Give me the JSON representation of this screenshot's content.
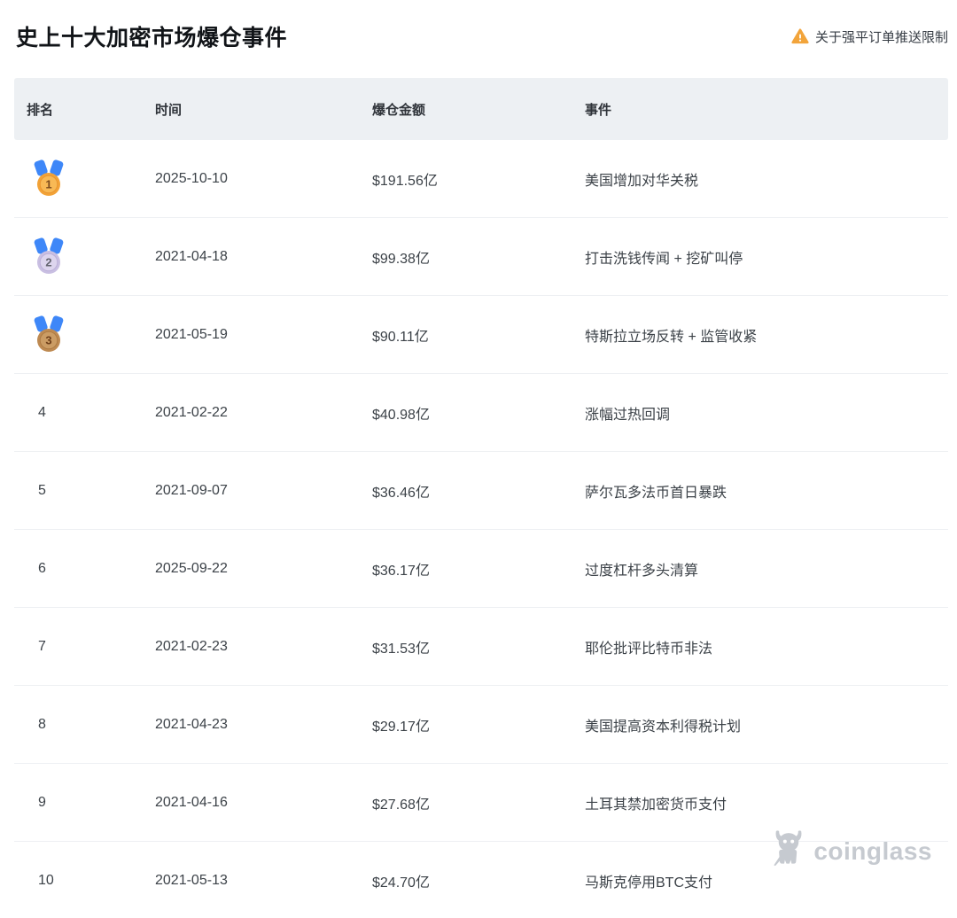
{
  "page": {
    "title": "史上十大加密市场爆仓事件",
    "notice": {
      "label": "关于强平订单推送限制",
      "icon": "warning-icon",
      "icon_color": "#F2A43B"
    }
  },
  "table": {
    "columns": [
      {
        "key": "rank",
        "label": "排名"
      },
      {
        "key": "time",
        "label": "时间"
      },
      {
        "key": "amount",
        "label": "爆仓金额"
      },
      {
        "key": "event",
        "label": "事件"
      }
    ],
    "rows": [
      {
        "rank": "1",
        "medal": "gold",
        "time": "2025-10-10",
        "amount": "$191.56亿",
        "event": "美国增加对华关税"
      },
      {
        "rank": "2",
        "medal": "silver",
        "time": "2021-04-18",
        "amount": "$99.38亿",
        "event": "打击洗钱传闻 + 挖矿叫停"
      },
      {
        "rank": "3",
        "medal": "bronze",
        "time": "2021-05-19",
        "amount": "$90.11亿",
        "event": "特斯拉立场反转 + 监管收紧"
      },
      {
        "rank": "4",
        "medal": null,
        "time": "2021-02-22",
        "amount": "$40.98亿",
        "event": "涨幅过热回调"
      },
      {
        "rank": "5",
        "medal": null,
        "time": "2021-09-07",
        "amount": "$36.46亿",
        "event": "萨尔瓦多法币首日暴跌"
      },
      {
        "rank": "6",
        "medal": null,
        "time": "2025-09-22",
        "amount": "$36.17亿",
        "event": "过度杠杆多头清算"
      },
      {
        "rank": "7",
        "medal": null,
        "time": "2021-02-23",
        "amount": "$31.53亿",
        "event": "耶伦批评比特币非法"
      },
      {
        "rank": "8",
        "medal": null,
        "time": "2021-04-23",
        "amount": "$29.17亿",
        "event": "美国提高资本利得税计划"
      },
      {
        "rank": "9",
        "medal": null,
        "time": "2021-04-16",
        "amount": "$27.68亿",
        "event": "土耳其禁加密货币支付"
      },
      {
        "rank": "10",
        "medal": null,
        "time": "2021-05-13",
        "amount": "$24.70亿",
        "event": "马斯克停用BTC支付"
      }
    ]
  },
  "medal_colors": {
    "ribbon": "#3E87F8",
    "gold": {
      "outer": "#F2A237",
      "inner": "#F8B955",
      "ring": "#E8952F",
      "number": "#7A4A1D"
    },
    "silver": {
      "outer": "#C9BFE2",
      "inner": "#DDD5EE",
      "ring": "#BBAFD8",
      "number": "#63646F"
    },
    "bronze": {
      "outer": "#BE8A52",
      "inner": "#CB9C64",
      "ring": "#AD7A42",
      "number": "#6E3F1A"
    }
  },
  "watermark": {
    "brand": "coinglass",
    "icon": "bull-logo-icon",
    "color": "#c6cad0"
  }
}
